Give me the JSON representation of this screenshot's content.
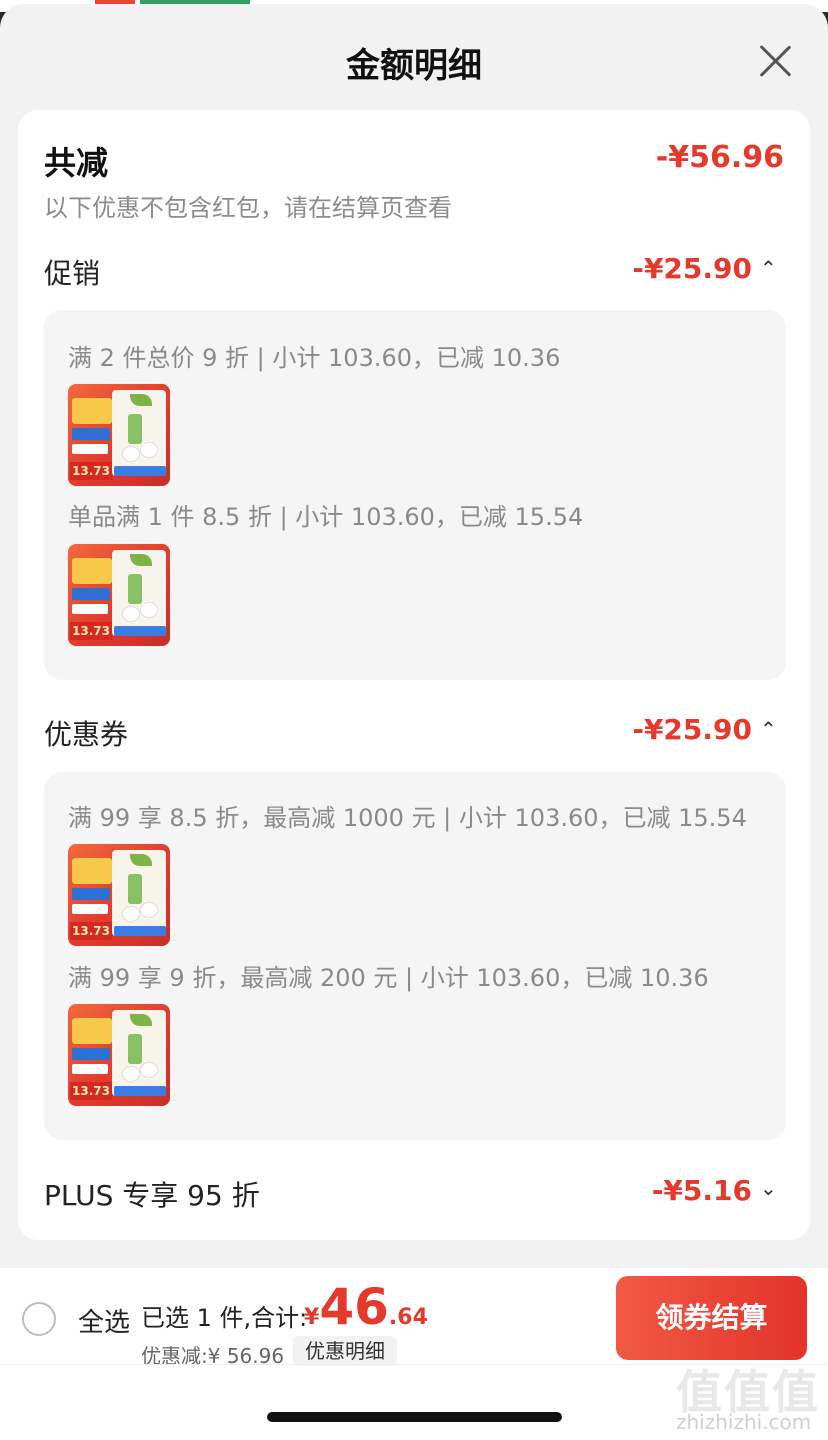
{
  "sheet": {
    "title": "金额明细"
  },
  "summary": {
    "label": "共减",
    "amount": "-¥56.96",
    "note": "以下优惠不包含红包，请在结算页查看"
  },
  "sections": {
    "promotion": {
      "label": "促销",
      "amount": "-¥25.90",
      "chevron": "chevron-up-icon",
      "rules": [
        {
          "text": "满 2 件总价 9 折 | 小计 103.60，已减 10.36",
          "thumb_price": "13.73"
        },
        {
          "text": "单品满 1 件 8.5 折 | 小计 103.60，已减 15.54",
          "thumb_price": "13.73"
        }
      ]
    },
    "coupon": {
      "label": "优惠券",
      "amount": "-¥25.90",
      "chevron": "chevron-up-icon",
      "rules": [
        {
          "text": "满 99 享 8.5 折，最高减 1000 元 | 小计 103.60，已减 15.54",
          "thumb_price": "13.73"
        },
        {
          "text": "满 99 享 9 折，最高减 200 元 | 小计 103.60，已减 10.36",
          "thumb_price": "13.73"
        }
      ]
    },
    "plus": {
      "label": "PLUS 专享 95 折",
      "amount": "-¥5.16",
      "chevron": "chevron-down-icon"
    }
  },
  "bottom_bar": {
    "select_all": "全选",
    "selected_count": "已选 1 件,合计:",
    "total_currency": "¥",
    "total_int": "46",
    "total_dec": ".64",
    "discount_text": "优惠减:¥ 56.96",
    "detail_button": "优惠明细",
    "checkout_button": "领券结算"
  },
  "watermark": {
    "glyph": "值值值",
    "url": "zhizhizhi.com"
  },
  "colors": {
    "accent": "#e4392b",
    "sheet_bg": "#f2f2f2",
    "card_bg": "#ffffff"
  }
}
